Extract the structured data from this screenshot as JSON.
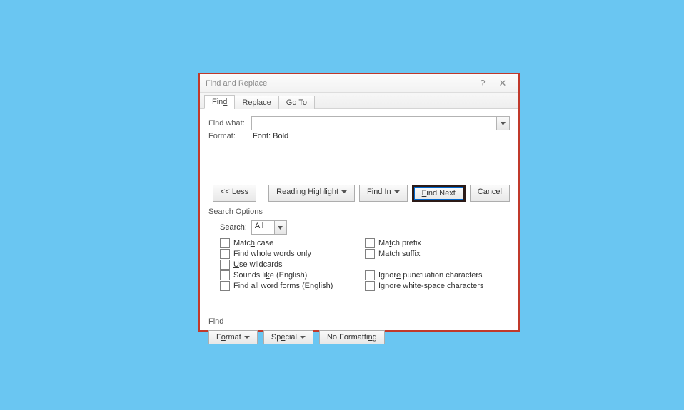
{
  "title": "Find and Replace",
  "tabs": [
    {
      "pre": "Fin",
      "u": "d"
    },
    {
      "pre": "Re",
      "u": "p",
      "post": "lace"
    },
    {
      "u": "G",
      "post": "o To"
    }
  ],
  "findwhat_label": "Find what:",
  "findwhat_value": "",
  "format_label": "Format:",
  "format_value": "Font: Bold",
  "buttons": {
    "less": "<< Less",
    "reading": "Reading Highlight",
    "findin": "Find In",
    "findnext": "Find Next",
    "cancel": "Cancel"
  },
  "search_options_legend": "Search Options",
  "search_label": "Search:",
  "search_value": "All",
  "chk_left": [
    {
      "pre": "Matc",
      "u": "h",
      "post": " case"
    },
    {
      "pre": "Find whole words onl",
      "u": "y",
      "post": ""
    },
    {
      "pre": "",
      "u": "U",
      "post": "se wildcards"
    },
    {
      "pre": "Sounds li",
      "u": "k",
      "post": "e (English)"
    },
    {
      "pre": "Find all ",
      "u": "w",
      "post": "ord forms (English)"
    }
  ],
  "chk_right": [
    {
      "pre": "Ma",
      "u": "t",
      "post": "ch prefix"
    },
    {
      "pre": "Match suffi",
      "u": "x",
      "post": ""
    },
    {
      "pre": "",
      "u": "",
      "post": ""
    },
    {
      "pre": "Ignor",
      "u": "e",
      "post": " punctuation characters"
    },
    {
      "pre": "Ignore white-",
      "u": "s",
      "post": "pace characters"
    }
  ],
  "find_legend": "Find",
  "format_btn": "Format",
  "special_btn": "Special",
  "noformat_btn": "No Formatting"
}
